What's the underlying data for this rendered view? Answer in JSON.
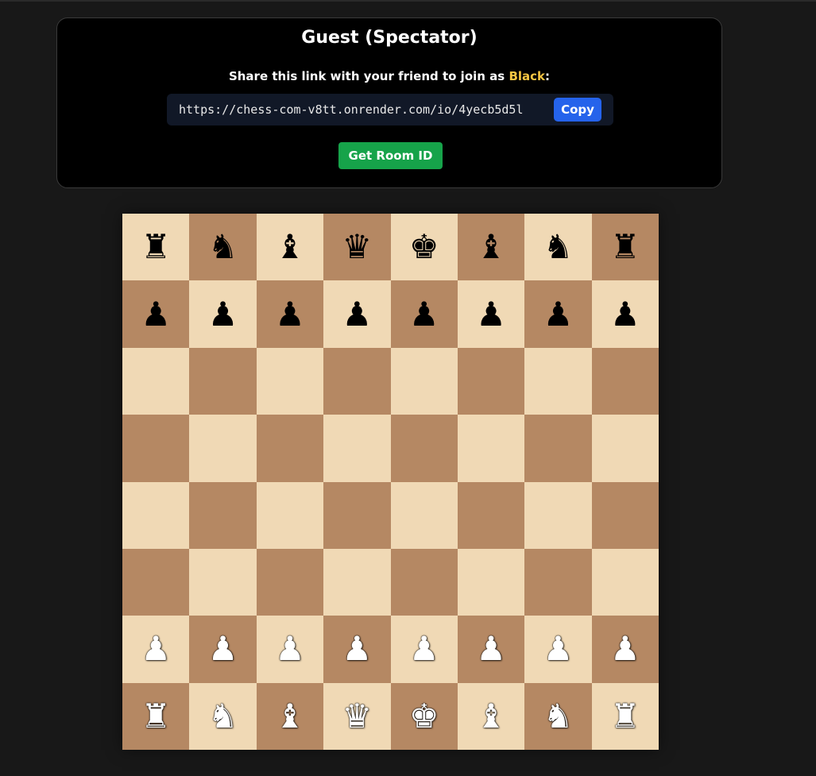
{
  "panel": {
    "title": "Guest (Spectator)",
    "share_prefix": "Share this link with your friend to join as ",
    "share_color": "Black",
    "share_suffix": ":",
    "link": "https://chess-com-v8tt.onrender.com/io/4yecb5d5l",
    "copy_label": "Copy",
    "room_button_label": "Get Room ID"
  },
  "colors": {
    "page_bg": "#181818",
    "light_square": "#f0d9b5",
    "dark_square": "#b58863",
    "copy_button": "#2563eb",
    "room_button": "#16a34a",
    "highlight_text": "#f5c542"
  },
  "board": {
    "ranks": [
      [
        "black-rook",
        "black-knight",
        "black-bishop",
        "black-queen",
        "black-king",
        "black-bishop",
        "black-knight",
        "black-rook"
      ],
      [
        "black-pawn",
        "black-pawn",
        "black-pawn",
        "black-pawn",
        "black-pawn",
        "black-pawn",
        "black-pawn",
        "black-pawn"
      ],
      [
        "",
        "",
        "",
        "",
        "",
        "",
        "",
        ""
      ],
      [
        "",
        "",
        "",
        "",
        "",
        "",
        "",
        ""
      ],
      [
        "",
        "",
        "",
        "",
        "",
        "",
        "",
        ""
      ],
      [
        "",
        "",
        "",
        "",
        "",
        "",
        "",
        ""
      ],
      [
        "white-pawn",
        "white-pawn",
        "white-pawn",
        "white-pawn",
        "white-pawn",
        "white-pawn",
        "white-pawn",
        "white-pawn"
      ],
      [
        "white-rook",
        "white-knight",
        "white-bishop",
        "white-queen",
        "white-king",
        "white-bishop",
        "white-knight",
        "white-rook"
      ]
    ]
  }
}
